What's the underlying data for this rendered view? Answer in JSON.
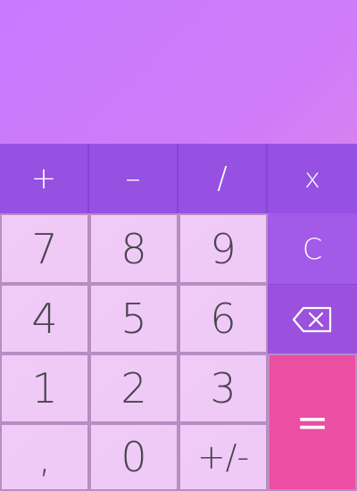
{
  "display": {
    "value": ""
  },
  "operators": {
    "plus": "+",
    "minus": "–",
    "divide": "/",
    "multiply": "x"
  },
  "keypad": {
    "k7": "7",
    "k8": "8",
    "k9": "9",
    "k4": "4",
    "k5": "5",
    "k6": "6",
    "k1": "1",
    "k2": "2",
    "k3": "3",
    "comma": ",",
    "k0": "0",
    "sign": "+/-"
  },
  "side": {
    "clear": "C",
    "backspace_icon": "backspace-icon",
    "equals": "="
  },
  "colors": {
    "display_gradient_start": "#c879ff",
    "display_gradient_end": "#e78fe0",
    "operator_bg": "#9650e2",
    "digit_bg": "#f1cbf8",
    "side_bg": "#a258e6",
    "equals_bg": "#ec4ea4"
  }
}
